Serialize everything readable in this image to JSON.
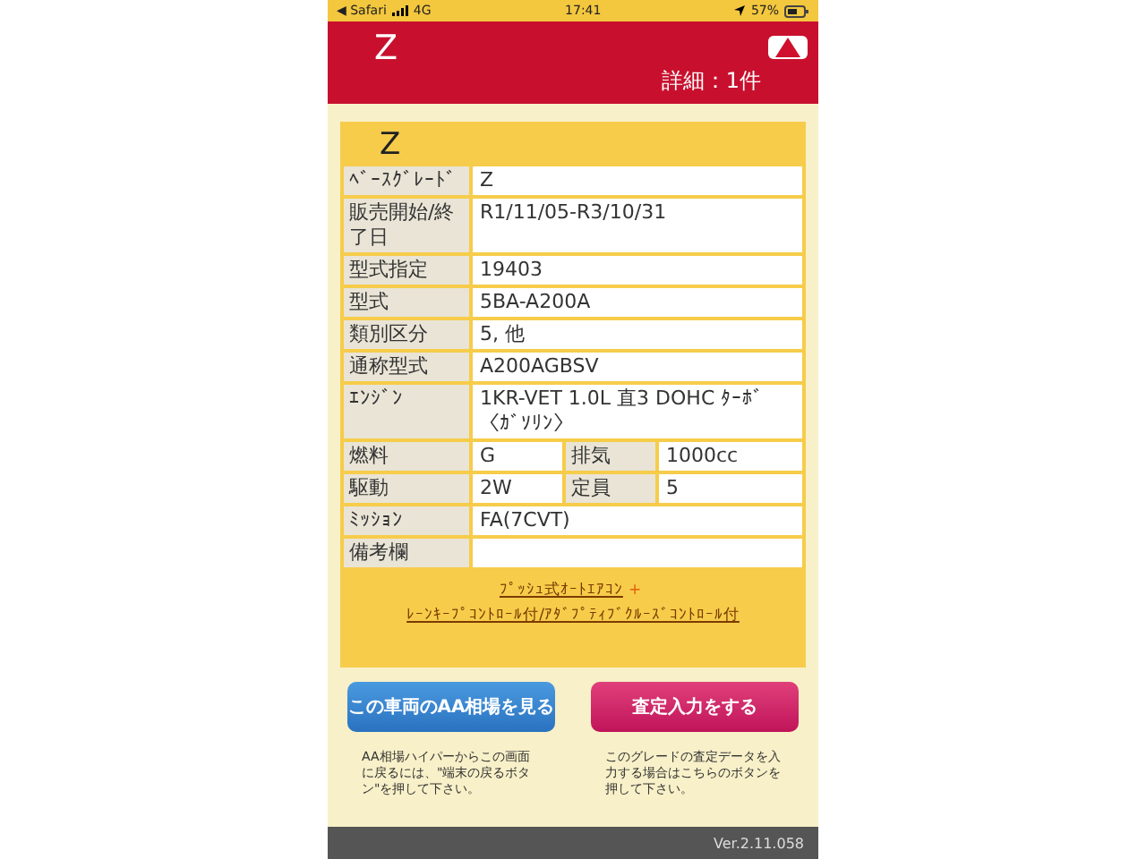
{
  "status_bar": {
    "back": "◀ Safari",
    "network": "4G",
    "time": "17:41",
    "battery": "57%"
  },
  "header": {
    "title": "Z",
    "count": "詳細：1件"
  },
  "card": {
    "title": "Z",
    "rows": [
      {
        "kind": "single",
        "label": "ﾍﾞｰｽｸﾞﾚｰﾄﾞ",
        "value": "Z"
      },
      {
        "kind": "single",
        "label": "販売開始/終了日",
        "value": "R1/11/05-R3/10/31"
      },
      {
        "kind": "single",
        "label": "型式指定",
        "value": "19403"
      },
      {
        "kind": "single",
        "label": "型式",
        "value": "5BA-A200A"
      },
      {
        "kind": "single",
        "label": "類別区分",
        "value": "5, 他"
      },
      {
        "kind": "single",
        "label": "通称型式",
        "value": "A200AGBSV"
      },
      {
        "kind": "single",
        "label": "ｴﾝｼﾞﾝ",
        "value": "1KR-VET 1.0L 直3 DOHC ﾀｰﾎﾞ〈ｶﾞｿﾘﾝ〉"
      },
      {
        "kind": "pair",
        "label": "燃料",
        "value": "G",
        "label2": "排気",
        "value2": "1000cc"
      },
      {
        "kind": "pair",
        "label": "駆動",
        "value": "2W",
        "label2": "定員",
        "value2": "5"
      },
      {
        "kind": "single",
        "label": "ﾐｯｼｮﾝ",
        "value": "FA(7CVT)"
      },
      {
        "kind": "single",
        "label": "備考欄",
        "value": ""
      }
    ],
    "options": [
      {
        "text": "ﾌﾟｯｼｭ式ｵｰﾄｴｱｺﾝ"
      },
      {
        "text": "ﾚｰﾝｷｰﾌﾟｺﾝﾄﾛｰﾙ付/ｱﾀﾞﾌﾟﾃｨﾌﾞｸﾙｰｽﾞｺﾝﾄﾛｰﾙ付"
      }
    ],
    "separator": "+"
  },
  "actions": [
    {
      "kind": "blue",
      "label": "この車両のAA相場を見る",
      "note": "AA相場ハイパーからこの画面に戻るには、\"端末の戻るボタン\"を押して下さい。"
    },
    {
      "kind": "pink",
      "label": "査定入力をする",
      "note": "このグレードの査定データを入力する場合はこちらのボタンを押して下さい。"
    }
  ],
  "footer": {
    "version": "Ver.2.11.058"
  }
}
